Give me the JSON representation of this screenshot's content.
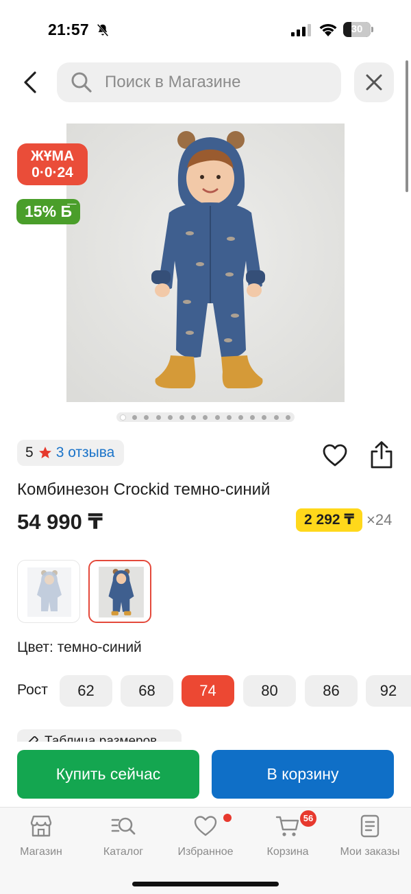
{
  "status_bar": {
    "time": "21:57",
    "battery_level": "30",
    "icons": [
      "bell-off-icon",
      "cellular-signal-icon",
      "wifi-icon",
      "battery-icon"
    ]
  },
  "header": {
    "search_placeholder": "Поиск в Магазине",
    "icons": [
      "back-arrow-icon",
      "search-icon",
      "close-icon"
    ]
  },
  "product": {
    "promo_badge_line1": "ЖҰМА",
    "promo_badge_line2": "0·0·24",
    "bonus_badge": "15% Б̅",
    "gallery_total": 15,
    "gallery_active_index": 0,
    "rating_value": "5",
    "reviews_link": "3 отзыва",
    "title": "Комбинезон Crockid темно-синий",
    "price": "54 990 ₸",
    "installment_amount": "2 292 ₸",
    "installment_times": "×24",
    "color_label": "Цвет: темно-синий",
    "size_label": "Рост",
    "sizes": [
      "62",
      "68",
      "74",
      "80",
      "86",
      "92"
    ],
    "selected_size": "74",
    "size_table_label": "Таблица размеров",
    "colors": {
      "promo_red": "#ea4d39",
      "bonus_green": "#4a9e2a",
      "installment_yellow": "#ffd81b",
      "link_blue": "#1a73c9"
    }
  },
  "actions": {
    "buy_now": "Купить сейчас",
    "add_to_cart": "В корзину",
    "buy_color": "#14a650",
    "cart_color": "#0f6fc7"
  },
  "bottom_nav": {
    "items": [
      {
        "label": "Магазин",
        "icon": "store-icon"
      },
      {
        "label": "Каталог",
        "icon": "catalog-search-icon"
      },
      {
        "label": "Избранное",
        "icon": "heart-icon"
      },
      {
        "label": "Корзина",
        "icon": "cart-icon"
      },
      {
        "label": "Мои заказы",
        "icon": "orders-icon"
      }
    ],
    "cart_badge": "56"
  }
}
